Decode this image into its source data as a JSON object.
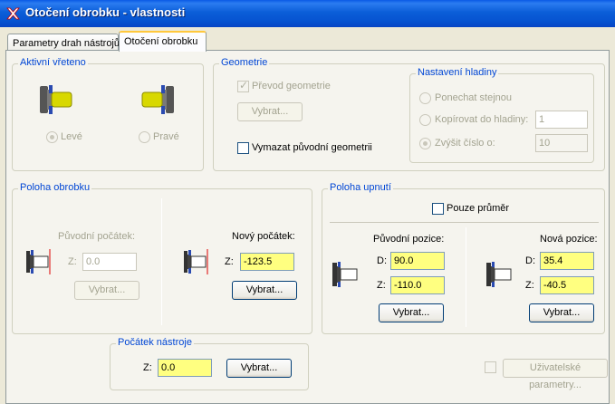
{
  "window": {
    "title": "Otočení obrobku - vlastnosti"
  },
  "tabs": [
    {
      "label": "Parametry drah nástrojů",
      "active": false
    },
    {
      "label": "Otočení obrobku",
      "active": true
    }
  ],
  "spindle": {
    "title": "Aktivní vřeteno",
    "left_label": "Levé",
    "right_label": "Pravé",
    "selected": "Levé"
  },
  "geometry": {
    "title": "Geometrie",
    "transfer_label": "Převod geometrie",
    "select_button": "Vybrat...",
    "delete_label": "Vymazat původní geometrii"
  },
  "layer": {
    "title": "Nastavení hladiny",
    "keep_label": "Ponechat stejnou",
    "copy_label": "Kopírovat do hladiny:",
    "copy_value": "1",
    "increase_label": "Zvýšit číslo o:",
    "increase_value": "10"
  },
  "stock_position": {
    "title": "Poloha obrobku",
    "orig_label": "Původní počátek:",
    "z_label": "Z:",
    "orig_z": "0.0",
    "orig_button": "Vybrat...",
    "new_label": "Nový počátek:",
    "new_z": "-123.5",
    "new_button": "Vybrat..."
  },
  "chuck_position": {
    "title": "Poloha upnutí",
    "diameter_only_label": "Pouze průměr",
    "orig_label": "Původní pozice:",
    "d_label": "D:",
    "z_label": "Z:",
    "orig_d": "90.0",
    "orig_z": "-110.0",
    "orig_button": "Vybrat...",
    "new_label": "Nová pozice:",
    "new_d": "35.4",
    "new_z": "-40.5",
    "new_button": "Vybrat..."
  },
  "tool_origin": {
    "title": "Počátek nástroje",
    "z_label": "Z:",
    "z_value": "0.0",
    "button": "Vybrat..."
  },
  "user_params": {
    "label": "Uživatelské parametry..."
  }
}
